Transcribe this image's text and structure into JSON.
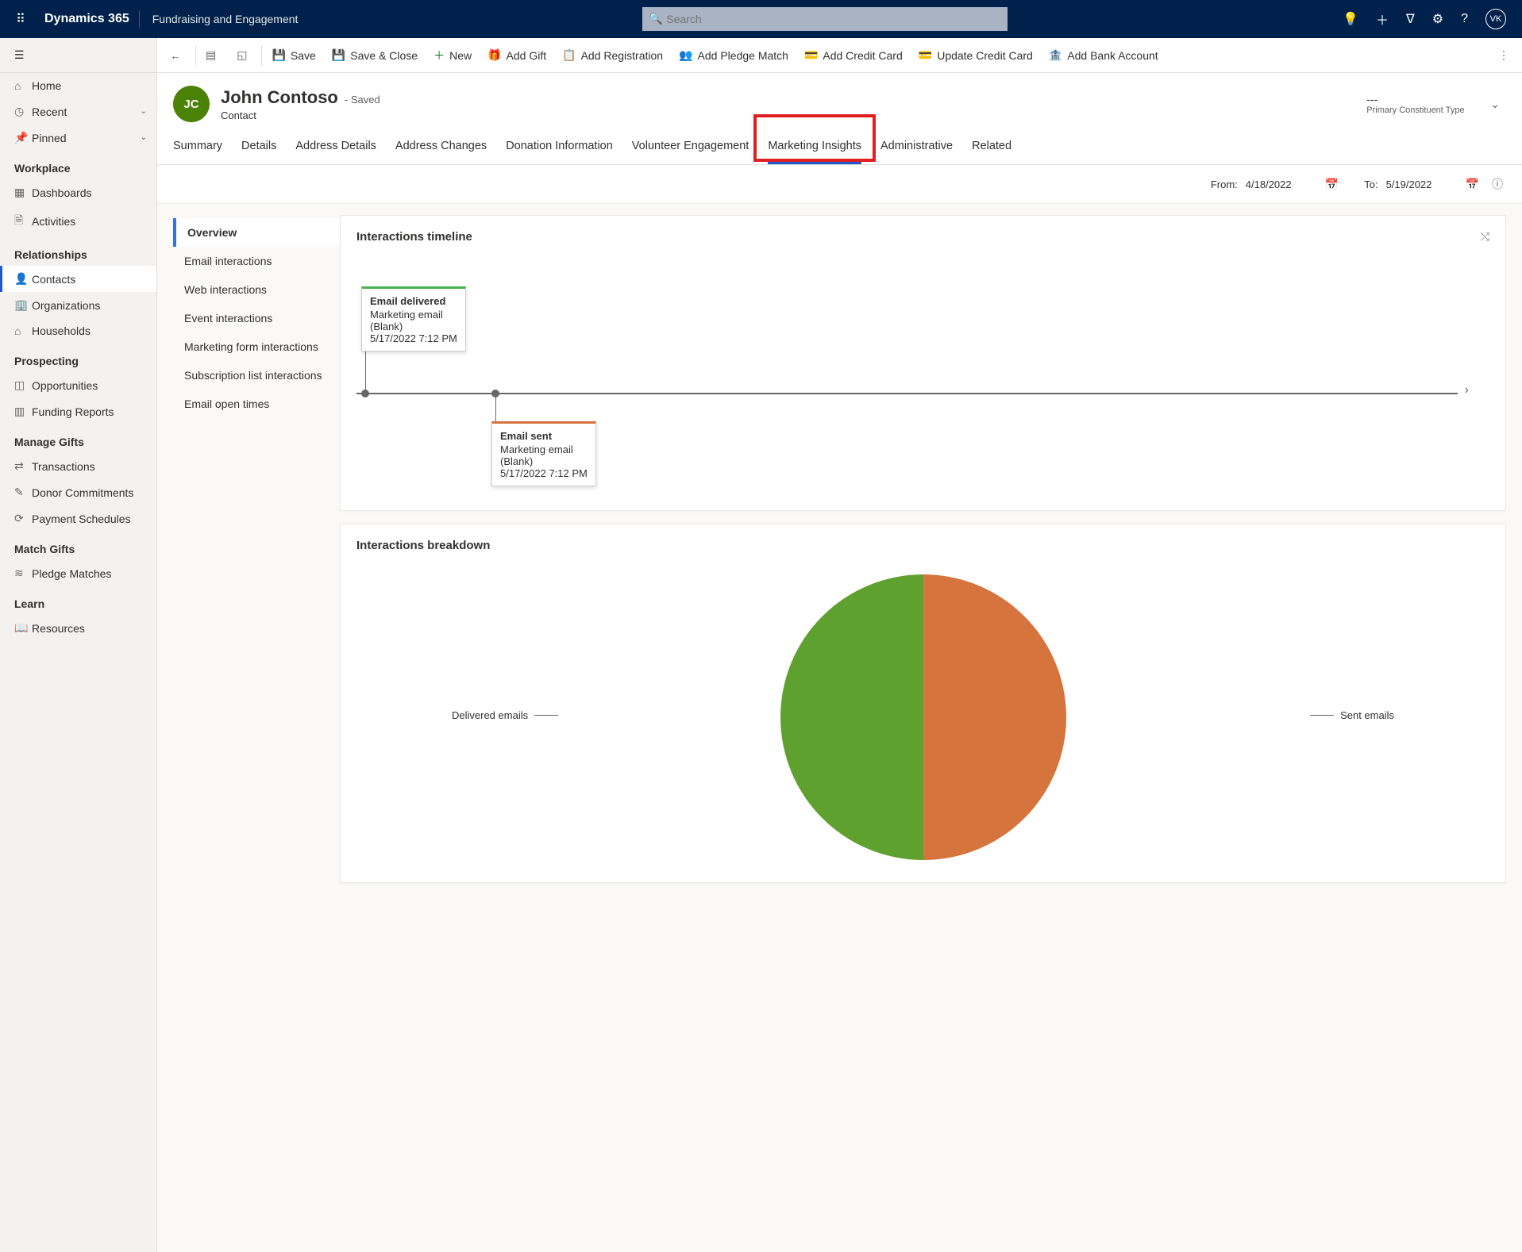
{
  "brand": {
    "name": "Dynamics 365",
    "module": "Fundraising and Engagement",
    "search_placeholder": "Search",
    "avatar_initials": "VK"
  },
  "leftnav": {
    "top": [
      {
        "label": "Home",
        "icon": "⌂"
      },
      {
        "label": "Recent",
        "icon": "◷",
        "chevron": true
      },
      {
        "label": "Pinned",
        "icon": "📌",
        "chevron": true
      }
    ],
    "sections": [
      {
        "heading": "Workplace",
        "items": [
          {
            "label": "Dashboards",
            "icon": "▦"
          },
          {
            "label": "Activities",
            "icon": "🗎"
          }
        ]
      },
      {
        "heading": "Relationships",
        "items": [
          {
            "label": "Contacts",
            "icon": "👤",
            "selected": true
          },
          {
            "label": "Organizations",
            "icon": "🏢"
          },
          {
            "label": "Households",
            "icon": "⌂"
          }
        ]
      },
      {
        "heading": "Prospecting",
        "items": [
          {
            "label": "Opportunities",
            "icon": "◫"
          },
          {
            "label": "Funding Reports",
            "icon": "▥"
          }
        ]
      },
      {
        "heading": "Manage Gifts",
        "items": [
          {
            "label": "Transactions",
            "icon": "⇄"
          },
          {
            "label": "Donor Commitments",
            "icon": "✎"
          },
          {
            "label": "Payment Schedules",
            "icon": "⟳"
          }
        ]
      },
      {
        "heading": "Match Gifts",
        "items": [
          {
            "label": "Pledge Matches",
            "icon": "≋"
          }
        ]
      },
      {
        "heading": "Learn",
        "items": [
          {
            "label": "Resources",
            "icon": "📖"
          }
        ]
      }
    ]
  },
  "commandbar": {
    "save": "Save",
    "save_close": "Save & Close",
    "new": "New",
    "add_gift": "Add Gift",
    "add_registration": "Add Registration",
    "add_pledge_match": "Add Pledge Match",
    "add_credit_card": "Add Credit Card",
    "update_credit_card": "Update Credit Card",
    "add_bank_account": "Add Bank Account"
  },
  "record": {
    "initials": "JC",
    "name": "John Contoso",
    "saved_tag": "- Saved",
    "entity": "Contact",
    "pct_value": "---",
    "pct_label": "Primary Constituent Type"
  },
  "tabs": [
    "Summary",
    "Details",
    "Address Details",
    "Address Changes",
    "Donation Information",
    "Volunteer Engagement",
    "Marketing Insights",
    "Administrative",
    "Related"
  ],
  "active_tab": "Marketing Insights",
  "date_filter": {
    "from_label": "From:",
    "from": "4/18/2022",
    "to_label": "To:",
    "to": "5/19/2022"
  },
  "insight_nav": [
    "Overview",
    "Email interactions",
    "Web interactions",
    "Event interactions",
    "Marketing form interactions",
    "Subscription list interactions",
    "Email open times"
  ],
  "insight_nav_selected": "Overview",
  "timeline": {
    "title": "Interactions timeline",
    "events": [
      {
        "title": "Email delivered",
        "line1": "Marketing email",
        "line2": "(Blank)",
        "ts": "5/17/2022 7:12 PM",
        "pos": "above",
        "color": "green"
      },
      {
        "title": "Email sent",
        "line1": "Marketing email",
        "line2": "(Blank)",
        "ts": "5/17/2022 7:12 PM",
        "pos": "below",
        "color": "orange"
      }
    ]
  },
  "breakdown": {
    "title": "Interactions breakdown",
    "left_label": "Delivered emails",
    "right_label": "Sent emails"
  },
  "chart_data": {
    "type": "pie",
    "title": "Interactions breakdown",
    "series": [
      {
        "name": "Delivered emails",
        "value": 1,
        "color": "#5fa12e"
      },
      {
        "name": "Sent emails",
        "value": 1,
        "color": "#d6743d"
      }
    ]
  }
}
